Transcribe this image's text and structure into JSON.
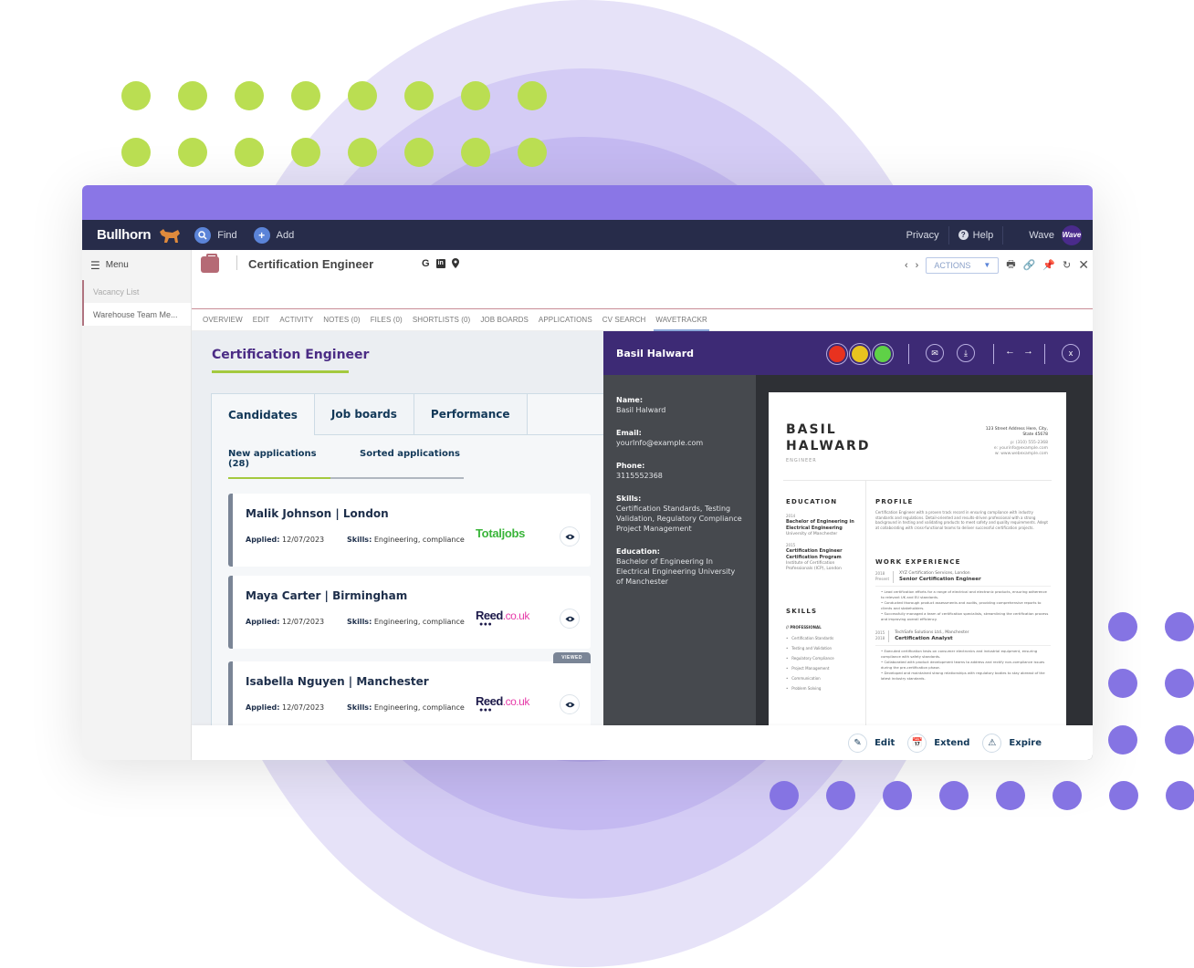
{
  "topnav": {
    "brand": "Bullhorn",
    "find_label": "Find",
    "add_label": "Add",
    "privacy_label": "Privacy",
    "help_label": "Help",
    "user_label": "Wave",
    "avatar_text": "Wave"
  },
  "sidebar": {
    "menu_label": "Menu",
    "items": [
      {
        "label": "Vacancy List"
      },
      {
        "label": "Warehouse Team Me..."
      }
    ]
  },
  "record": {
    "title": "Certification Engineer",
    "icon_g": "G",
    "icon_in": "in",
    "actions_label": "ACTIONS"
  },
  "tabs": [
    {
      "label": "OVERVIEW"
    },
    {
      "label": "EDIT"
    },
    {
      "label": "ACTIVITY"
    },
    {
      "label": "NOTES (0)"
    },
    {
      "label": "FILES (0)"
    },
    {
      "label": "SHORTLISTS (0)"
    },
    {
      "label": "JOB BOARDS"
    },
    {
      "label": "APPLICATIONS"
    },
    {
      "label": "CV SEARCH"
    },
    {
      "label": "WAVETRACKR",
      "active": true
    }
  ],
  "vacancy": {
    "title": "Certification Engineer",
    "panel_tabs": [
      {
        "label": "Candidates",
        "active": true
      },
      {
        "label": "Job boards"
      },
      {
        "label": "Performance"
      }
    ],
    "sub_tabs": [
      {
        "label": "New applications (28)",
        "active": true
      },
      {
        "label": "Sorted applications"
      }
    ],
    "applied_label": "Applied:",
    "skills_label": "Skills:",
    "candidates": [
      {
        "name": "Malik Johnson | London",
        "applied": "12/07/2023",
        "skills": "Engineering, compliance",
        "board": "Totaljobs",
        "viewed": false
      },
      {
        "name": "Maya Carter | Birmingham",
        "applied": "12/07/2023",
        "skills": "Engineering, compliance",
        "board": "Reed.co.uk",
        "board_main": "Reed",
        "board_suffix": ".co.uk",
        "viewed": false
      },
      {
        "name": "Isabella Nguyen | Manchester",
        "applied": "12/07/2023",
        "skills": "Engineering, compliance",
        "board": "Reed.co.uk",
        "board_main": "Reed",
        "board_suffix": ".co.uk",
        "viewed": true,
        "viewed_label": "VIEWED"
      }
    ]
  },
  "cv_panel": {
    "candidate_name": "Basil Halward",
    "status_colors": {
      "red": "#e8321f",
      "amber": "#e8c31f",
      "green": "#5fd147"
    },
    "info": [
      {
        "label": "Name:",
        "value": "Basil Halward"
      },
      {
        "label": "Email:",
        "value": "yourInfo@example.com"
      },
      {
        "label": "Phone:",
        "value": "3115552368"
      },
      {
        "label": "Skills:",
        "value": "Certification Standards, Testing Validation, Regulatory Compliance Project Management"
      },
      {
        "label": "Education:",
        "value": "Bachelor of Engineering In Electrical Engineering University of Manchester"
      }
    ],
    "resume": {
      "first_name": "BASIL",
      "last_name": "HALWARD",
      "role": "ENGINEER",
      "address_1": "123 Street Address Here, City,",
      "address_2": "State 45678",
      "phone": "p: (310) 555-2368",
      "email": "e: yourinfo@example.com",
      "web": "w: www.webexample.com",
      "education_title": "EDUCATION",
      "education": [
        {
          "year": "2014",
          "degree": "Bachelor of Engineering in Electrical Engineering",
          "school": "University of Manchester"
        },
        {
          "year": "2015",
          "degree": "Certification Engineer Certification Program",
          "school": "Institute of Certification Professionals (ICP), London"
        }
      ],
      "skills_title": "SKILLS",
      "skills_group": "// PROFESSIONAL",
      "skills": [
        "Certification Standards",
        "Testing and Validation",
        "Regulatory Compliance",
        "Project Management",
        "Communication",
        "Problem Solving"
      ],
      "profile_title": "PROFILE",
      "profile": "Certification Engineer with a proven track record in ensuring compliance with industry standards and regulations. Detail-oriented and results-driven professional with a strong background in testing and validating products to meet safety and quality requirements. Adept at collaborating with cross-functional teams to deliver successful certification projects.",
      "work_title": "WORK EXPERIENCE",
      "jobs": [
        {
          "from": "2018",
          "to": "Present",
          "company": "XYZ Certification Services, London",
          "title": "Senior Certification Engineer",
          "bullets": [
            "Lead certification efforts for a range of electrical and electronic products, ensuring adherence to relevant UK and EU standards.",
            "Conducted thorough product assessments and audits, providing comprehensive reports to clients and stakeholders.",
            "Successfully managed a team of certification specialists, streamlining the certification process and improving overall efficiency."
          ]
        },
        {
          "from": "2015",
          "to": "2018",
          "company": "TechSafe Solutions Ltd., Manchester",
          "title": "Certification Analyst",
          "bullets": [
            "Executed certification tests on consumer electronics and industrial equipment, ensuring compliance with safety standards.",
            "Collaborated with product development teams to address and rectify non-compliance issues during the pre-certification phase.",
            "Developed and maintained strong relationships with regulatory bodies to stay abreast of the latest industry standards."
          ]
        }
      ]
    }
  },
  "footer": {
    "edit_label": "Edit",
    "extend_label": "Extend",
    "expire_label": "Expire"
  },
  "colors": {
    "window_bar": "#8a76e6",
    "nav_bg": "#272c4a",
    "cv_header": "#3d2a75",
    "accent_green": "#a4c93f",
    "dot_green": "#bade52",
    "dot_purple": "#8574e3"
  }
}
